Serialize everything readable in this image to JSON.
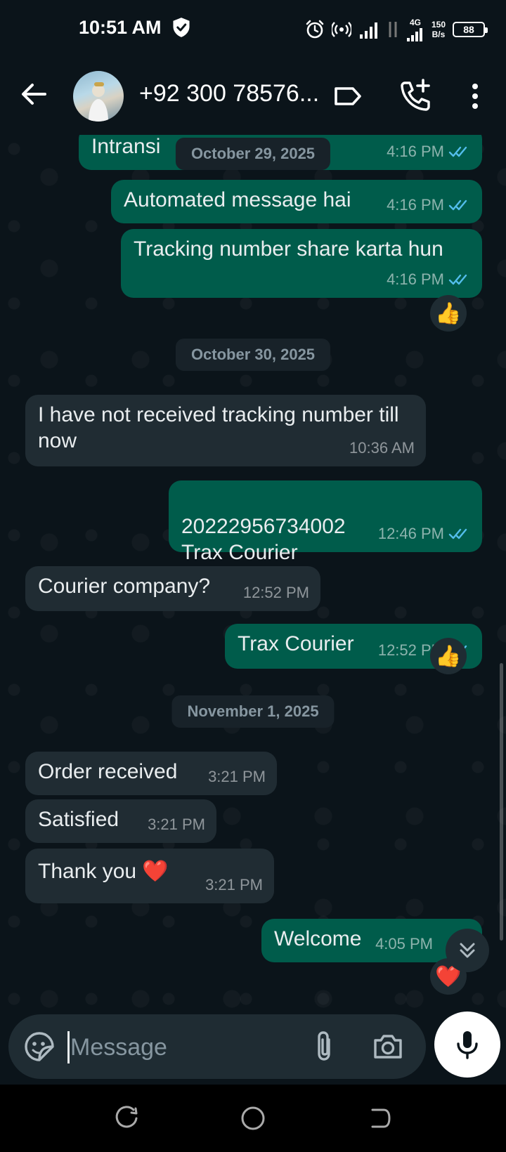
{
  "status_bar": {
    "time": "10:51 AM",
    "network_type": "4G",
    "speed_value": "150",
    "speed_unit": "B/s",
    "battery": "88"
  },
  "header": {
    "contact_name": "+92 300 78576..."
  },
  "messages": [
    {
      "id": "m1",
      "direction": "out",
      "text": "Intransi",
      "time": "4:16 PM"
    },
    {
      "id": "m2",
      "direction": "out",
      "text": "Automated message hai",
      "time": "4:16 PM"
    },
    {
      "id": "m3",
      "direction": "out",
      "text": "Tracking number share karta hun",
      "time": "4:16 PM",
      "reaction": "👍"
    },
    {
      "id": "m4",
      "direction": "in",
      "text": "I have not received tracking number till now",
      "time": "10:36 AM"
    },
    {
      "id": "m5",
      "direction": "out",
      "text": "20222956734002\nTrax Courier",
      "time": "12:46 PM"
    },
    {
      "id": "m6",
      "direction": "in",
      "text": "Courier company?",
      "time": "12:52 PM"
    },
    {
      "id": "m7",
      "direction": "out",
      "text": "Trax Courier",
      "time": "12:52 PM",
      "reaction": "👍"
    },
    {
      "id": "m8",
      "direction": "in",
      "text": "Order received",
      "time": "3:21 PM"
    },
    {
      "id": "m9",
      "direction": "in",
      "text": "Satisfied",
      "time": "3:21 PM"
    },
    {
      "id": "m10",
      "direction": "in",
      "text": "Thank you ❤️",
      "time": "3:21 PM"
    },
    {
      "id": "m11",
      "direction": "out",
      "text": "Welcome",
      "time": "4:05 PM",
      "reaction": "❤️"
    }
  ],
  "date_chips": [
    "October 29, 2025",
    "October 30, 2025",
    "November 1, 2025"
  ],
  "compose": {
    "placeholder": "Message"
  },
  "icons": {
    "back": "arrow-left-icon",
    "label": "label-icon",
    "add_call": "add-call-icon",
    "menu": "more-vert-icon",
    "sticker": "sticker-icon",
    "attach": "paperclip-icon",
    "camera": "camera-icon",
    "mic": "mic-icon",
    "scroll_down": "double-chevron-down-icon"
  },
  "colors": {
    "background": "#0b141a",
    "outgoing_bubble": "#005c4b",
    "incoming_bubble": "#202c33",
    "read_ticks": "#53bdeb",
    "date_chip": "#182229"
  }
}
